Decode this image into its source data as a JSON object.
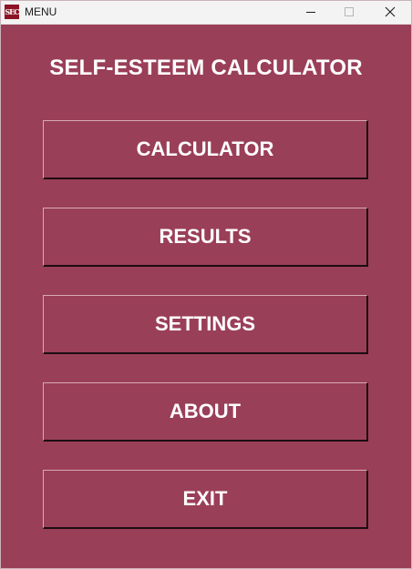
{
  "window": {
    "title": "MENU",
    "icon_text": "SEC",
    "controls": {
      "minimize": "minimize-icon",
      "maximize": "maximize-icon",
      "close": "close-icon"
    }
  },
  "main": {
    "heading": "SELF-ESTEEM CALCULATOR",
    "buttons": [
      {
        "label": "CALCULATOR"
      },
      {
        "label": "RESULTS"
      },
      {
        "label": "SETTINGS"
      },
      {
        "label": "ABOUT"
      },
      {
        "label": "EXIT"
      }
    ]
  },
  "colors": {
    "background": "#9a3f58",
    "text": "#ffffff",
    "titlebar": "#f3f3f3",
    "icon": "#8c1325"
  }
}
